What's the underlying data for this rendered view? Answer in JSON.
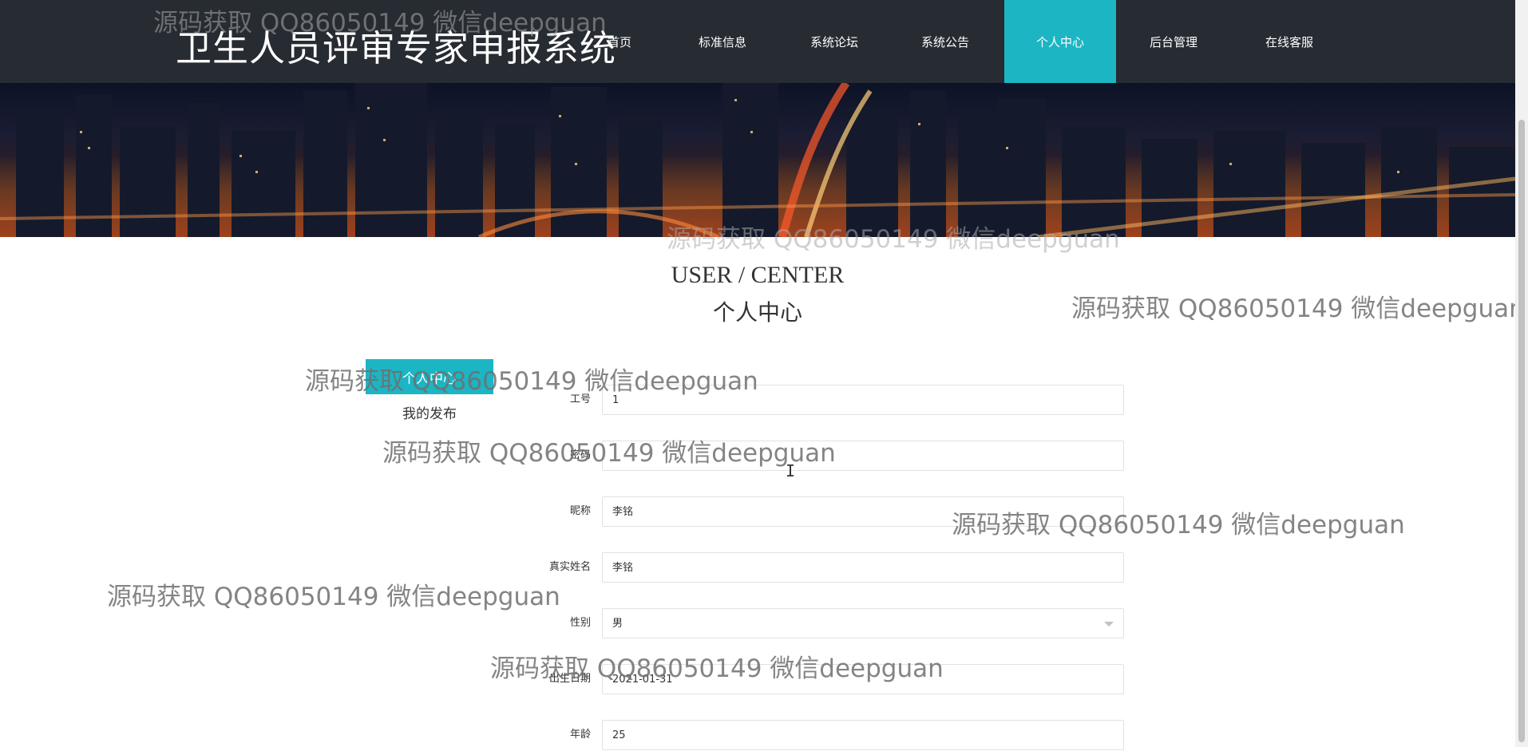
{
  "site_title": "卫生人员评审专家申报系统",
  "nav": [
    {
      "label": "首页",
      "active": false
    },
    {
      "label": "标准信息",
      "active": false
    },
    {
      "label": "系统论坛",
      "active": false
    },
    {
      "label": "系统公告",
      "active": false
    },
    {
      "label": "个人中心",
      "active": true
    },
    {
      "label": "后台管理",
      "active": false
    },
    {
      "label": "在线客服",
      "active": false
    }
  ],
  "section": {
    "title_en": "USER / CENTER",
    "title_cn": "个人中心"
  },
  "side_menu": [
    {
      "label": "个人中心",
      "active": true
    },
    {
      "label": "我的发布",
      "active": false
    }
  ],
  "form": {
    "fields": [
      {
        "label": "工号",
        "value": "1"
      },
      {
        "label": "密码",
        "value": ""
      },
      {
        "label": "昵称",
        "value": "李铭"
      },
      {
        "label": "真实姓名",
        "value": "李铭"
      },
      {
        "label": "性别",
        "value": "男",
        "type": "select"
      },
      {
        "label": "出生日期",
        "value": "2021-01-31"
      },
      {
        "label": "年龄",
        "value": "25"
      }
    ]
  },
  "watermark": {
    "text": "源码获取 QQ86050149 微信deepguan"
  },
  "colors": {
    "accent": "#1cb5c4",
    "nav_bg": "#272b32"
  }
}
